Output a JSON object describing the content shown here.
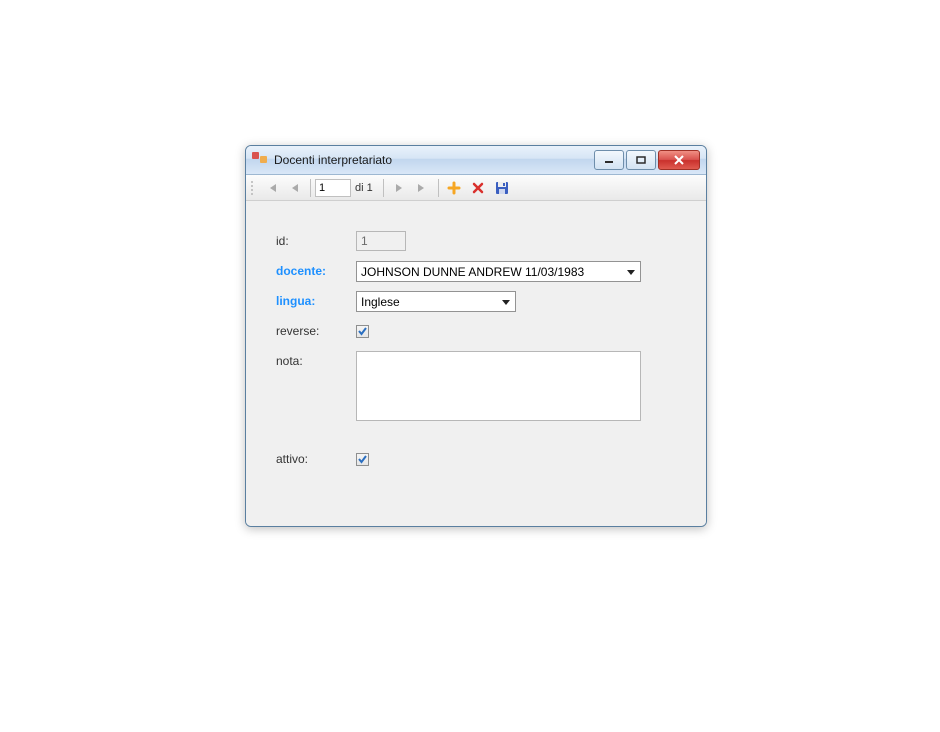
{
  "window": {
    "title": "Docenti interpretariato"
  },
  "navigator": {
    "position": "1",
    "count_text": "di 1"
  },
  "form": {
    "id": {
      "label": "id:",
      "value": "1"
    },
    "docente": {
      "label": "docente:",
      "value": "JOHNSON DUNNE ANDREW 11/03/1983"
    },
    "lingua": {
      "label": "lingua:",
      "value": "Inglese"
    },
    "reverse": {
      "label": "reverse:",
      "checked": true
    },
    "nota": {
      "label": "nota:",
      "value": ""
    },
    "attivo": {
      "label": "attivo:",
      "checked": true
    }
  }
}
